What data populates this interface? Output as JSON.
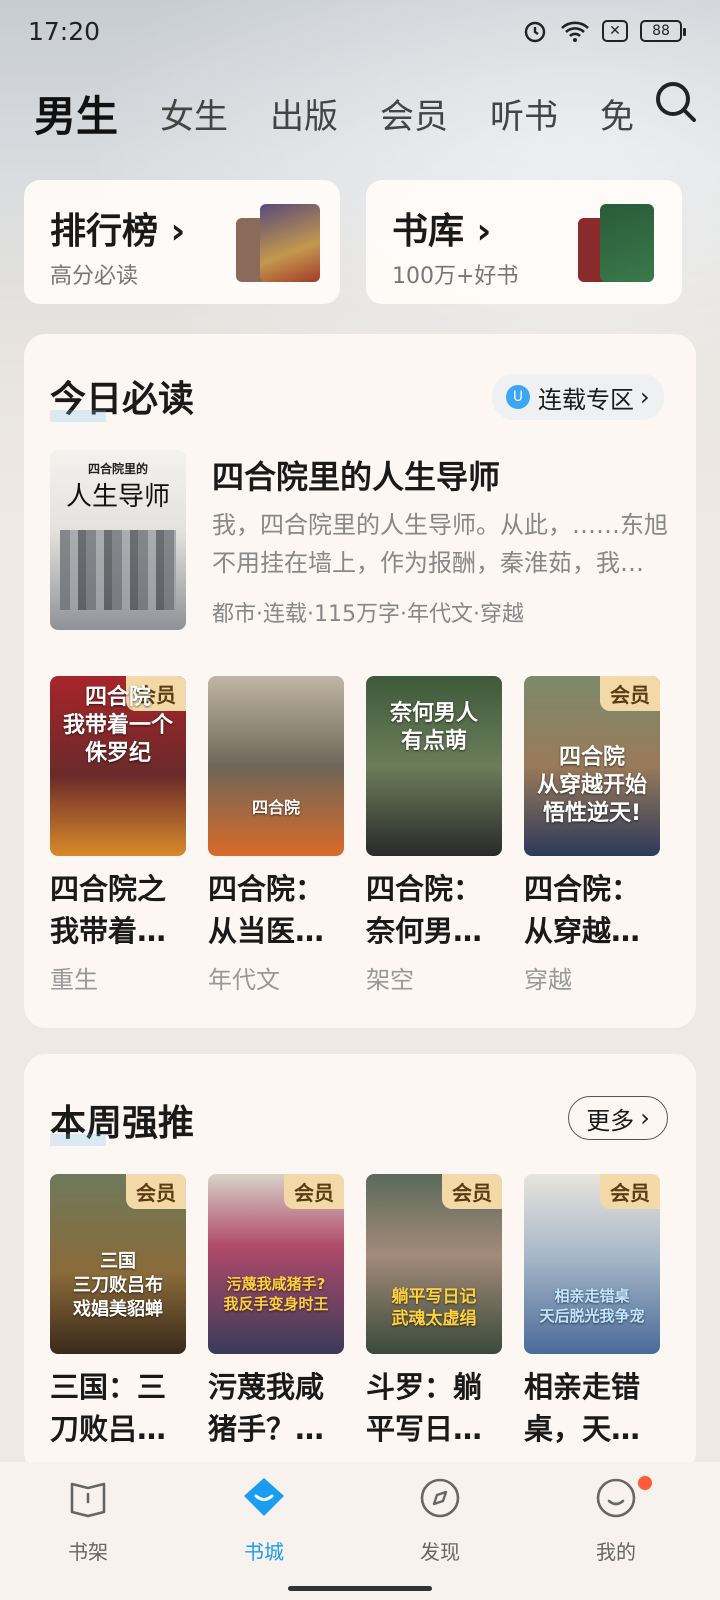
{
  "status": {
    "time": "17:20",
    "battery": "88"
  },
  "tabs": [
    "男生",
    "女生",
    "出版",
    "会员",
    "听书",
    "免"
  ],
  "top_cards": [
    {
      "title": "排行榜",
      "sub": "高分必读"
    },
    {
      "title": "书库",
      "sub": "100万+好书"
    }
  ],
  "today": {
    "title": "今日必读",
    "pill": "连载专区",
    "featured": {
      "title": "四合院里的人生导师",
      "desc": "我，四合院里的人生导师。从此，……东旭不用挂在墙上，作为报酬，秦淮茹，我…",
      "meta": "都市·连载·115万字·年代文·穿越",
      "cover_title": "四合院里的",
      "cover_big": "人生导师"
    },
    "books": [
      {
        "name": "四合院之我带着…",
        "tag": "重生",
        "vip": "会员",
        "cover": "四合院\n我带着一个\n侏罗纪"
      },
      {
        "name": "四合院：从当医…",
        "tag": "年代文",
        "vip": "",
        "cover": "四合院"
      },
      {
        "name": "四合院：奈何男…",
        "tag": "架空",
        "vip": "",
        "cover": "奈何男人\n有点萌"
      },
      {
        "name": "四合院：从穿越…",
        "tag": "穿越",
        "vip": "会员",
        "cover": "四合院\n从穿越开始\n悟性逆天!"
      }
    ]
  },
  "weekly": {
    "title": "本周强推",
    "more": "更多",
    "books": [
      {
        "name": "三国：三刀败吕…",
        "vip": "会员",
        "cover": "三国\n三刀败吕布\n戏娼美貂蝉"
      },
      {
        "name": "污蔑我咸猪手？…",
        "vip": "会员",
        "cover": "污蔑我咸猪手?\n我反手变身时王"
      },
      {
        "name": "斗罗：躺平写日…",
        "vip": "会员",
        "cover": "躺平写日记\n武魂太虚绢"
      },
      {
        "name": "相亲走错桌，天…",
        "vip": "会员",
        "cover": "相亲走错桌\n天后脱光我争宠"
      }
    ]
  },
  "nav": [
    "书架",
    "书城",
    "发现",
    "我的"
  ],
  "colors": {
    "accent": "#1a9cf0",
    "vip_bg": "#f3d9a7"
  }
}
